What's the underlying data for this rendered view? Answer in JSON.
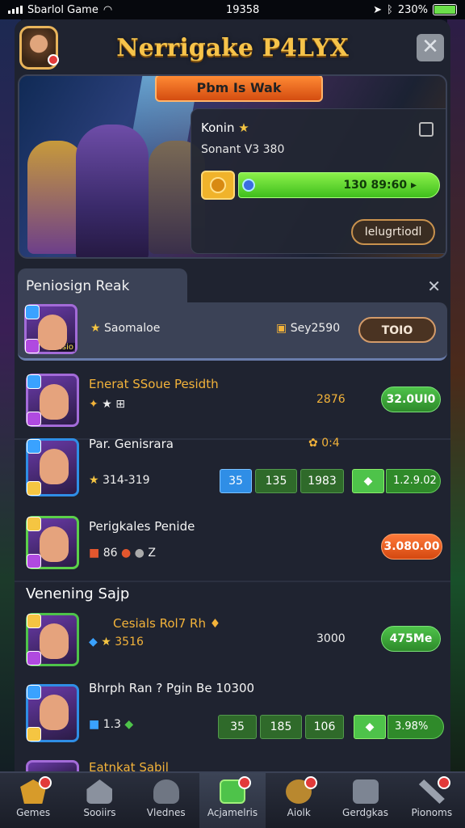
{
  "status": {
    "left_text": "Sbarlol Game",
    "time": "19358",
    "battery": "230%"
  },
  "header": {
    "title": "Nerrigake P4LYX",
    "close_glyph": "✕"
  },
  "hero": {
    "banner": "Pbm Is Wak",
    "player_name": "Konin",
    "player_sub": "Sonant V3 380",
    "progress_text": "130 89:60",
    "button": "Ielugrtiodl"
  },
  "section1": {
    "title": "Peniosign Reak",
    "close": "✕",
    "highlight": {
      "name": "Saomaloe",
      "value": "Sey2590",
      "card_label": "ausio",
      "button": "TOIO"
    }
  },
  "rows": [
    {
      "title": "Enerat SSoue Pesidth",
      "value": "2876",
      "button": "32.0UI0"
    },
    {
      "title": "Par. Genisrara",
      "value": "0:4",
      "sub": "314-319",
      "steps": [
        "35",
        "135",
        "1983"
      ],
      "arrow": "1.2.9.02"
    },
    {
      "title": "Perigkales Penide",
      "sub_a": "86",
      "sub_b": "Z",
      "button": "3.080.00"
    }
  ],
  "section2": {
    "title": "Venening Sajp"
  },
  "rows2": [
    {
      "title": "Cesials Rol7 Rh",
      "sub": "3516",
      "value": "3000",
      "button": "475Me"
    },
    {
      "title": "Bhrph Ran ? Pgin Be 10300",
      "sub": "1.3",
      "steps": [
        "35",
        "185",
        "106"
      ],
      "arrow": "3.98%"
    },
    {
      "title": "Eatnkat Sabil"
    }
  ],
  "nav": [
    {
      "label": "Gemes",
      "icon": "shield-icon",
      "badge": true
    },
    {
      "label": "Sooiirs",
      "icon": "house-icon",
      "badge": false
    },
    {
      "label": "Vlednes",
      "icon": "helmet-icon",
      "badge": false
    },
    {
      "label": "Acjamelris",
      "icon": "brush-icon",
      "badge": true,
      "active": true
    },
    {
      "label": "Aiolk",
      "icon": "ball-icon",
      "badge": true
    },
    {
      "label": "Gerdgkas",
      "icon": "document-icon",
      "badge": false
    },
    {
      "label": "Pionoms",
      "icon": "pickaxe-icon",
      "badge": true
    }
  ]
}
